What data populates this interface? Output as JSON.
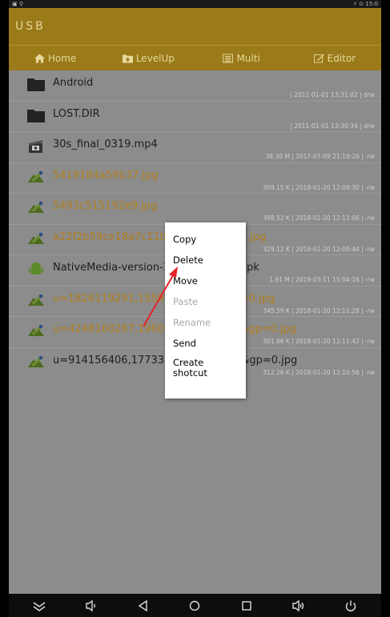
{
  "app": {
    "title": "USB"
  },
  "statusbar": {
    "left": "▣ ⚲",
    "right": "⚡ ⊙ 15:0"
  },
  "toolbar": {
    "buttons": [
      {
        "label": "Home",
        "icon": "home-icon"
      },
      {
        "label": "LevelUp",
        "icon": "folder-up-icon"
      },
      {
        "label": "Multi",
        "icon": "multi-select-icon"
      },
      {
        "label": "Editor",
        "icon": "edit-icon"
      }
    ]
  },
  "files": [
    {
      "name": "Android",
      "meta": "| 2011-01-01 13:31:02 | drw",
      "type": "folder",
      "color": "#1e1e1e"
    },
    {
      "name": "LOST.DIR",
      "meta": "| 2011-01-01 13:30:34 | drw",
      "type": "folder",
      "color": "#1e1e1e"
    },
    {
      "name": "30s_final_0319.mp4",
      "meta": "38.30 M | 2017-07-09 21:19:26 | -rw",
      "type": "video",
      "color": "#1e1e1e"
    },
    {
      "name": "5419184a59b37.jpg",
      "meta": "309.15 K | 2018-01-20 12:09:30 | -rw",
      "type": "image",
      "color": "#b07f1c"
    },
    {
      "name": "5493c515192e9.jpg",
      "meta": "398.52 K | 2018-01-20 12:11:06 | -rw",
      "type": "image",
      "color": "#b07f1c"
    },
    {
      "name": "a22f2b59ce18a7c11b",
      "name_tail": "e.jpg",
      "meta": "329.12 K | 2018-01-20 12:00:44 | -rw",
      "type": "image",
      "color": "#b07f1c"
    },
    {
      "name": "NativeMedia-version-1",
      "name_tail": "apk",
      "meta": "1.91 M | 2019-03-11 15:04:16 | -rw",
      "type": "apk",
      "color": "#1e1e1e"
    },
    {
      "name": "u=1826119291,15597",
      "name_tail": "=0.jpg",
      "meta": "345.59 K | 2018-01-20 12:11:28 | -rw",
      "type": "image",
      "color": "#b07f1c"
    },
    {
      "name": "u=4248160287,19605",
      "name_tail": "&gp=0.jpg",
      "meta": "301.96 K | 2018-01-20 12:11:42 | -rw",
      "type": "image",
      "color": "#b07f1c"
    },
    {
      "name": "u=914156406,177336818&fm=214&gp=0.jpg",
      "meta": "312.26 K | 2018-01-20 12:10:56 | -rw",
      "type": "image",
      "color": "#1e1e1e"
    }
  ],
  "context_menu": {
    "items": [
      {
        "label": "Copy",
        "enabled": true
      },
      {
        "label": "Delete",
        "enabled": true
      },
      {
        "label": "Move",
        "enabled": true
      },
      {
        "label": "Paste",
        "enabled": false
      },
      {
        "label": "Rename",
        "enabled": false
      },
      {
        "label": "Send",
        "enabled": true
      }
    ],
    "create_shortcut": {
      "line1": "Create",
      "line2": "shotcut"
    }
  },
  "navbar": {
    "icons": [
      "collapse-icon",
      "volume-down-icon",
      "back-icon",
      "home-circle-icon",
      "recents-icon",
      "volume-up-icon",
      "power-icon"
    ]
  },
  "colors": {
    "accent": "#9a7a19",
    "accent_text": "#e6d79a",
    "list_bg": "#8c8c8c",
    "orange_text": "#b07f1c",
    "arrow": "#e8202a"
  }
}
